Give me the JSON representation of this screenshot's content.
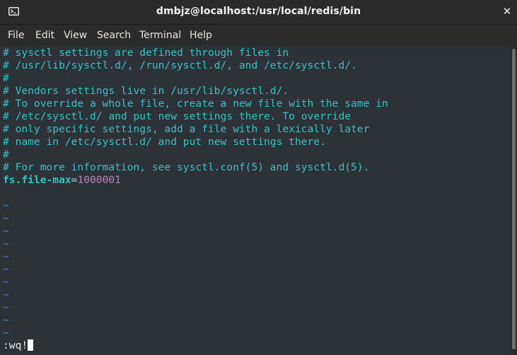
{
  "window": {
    "title": "dmbjz@localhost:/usr/local/redis/bin",
    "close_glyph": "✕"
  },
  "menu": [
    "File",
    "Edit",
    "View",
    "Search",
    "Terminal",
    "Help"
  ],
  "editor": {
    "comment_lines": [
      "# sysctl settings are defined through files in",
      "# /usr/lib/sysctl.d/, /run/sysctl.d/, and /etc/sysctl.d/.",
      "#",
      "# Vendors settings live in /usr/lib/sysctl.d/.",
      "# To override a whole file, create a new file with the same in",
      "# /etc/sysctl.d/ and put new settings there. To override",
      "# only specific settings, add a file with a lexically later",
      "# name in /etc/sysctl.d/ and put new settings there.",
      "#",
      "# For more information, see sysctl.conf(5) and sysctl.d(5)."
    ],
    "setting": {
      "key": "fs.file-max",
      "eq": "=",
      "value": "1000001"
    },
    "tilde_char": "~",
    "tilde_count": 11,
    "command_line": ":wq!"
  },
  "colors": {
    "comment": "#35c3c8",
    "value": "#b583c0",
    "tilde": "#3e6ab0",
    "background": "#2d3236"
  },
  "icons": {
    "terminal": "terminal-icon",
    "close": "close-icon"
  }
}
